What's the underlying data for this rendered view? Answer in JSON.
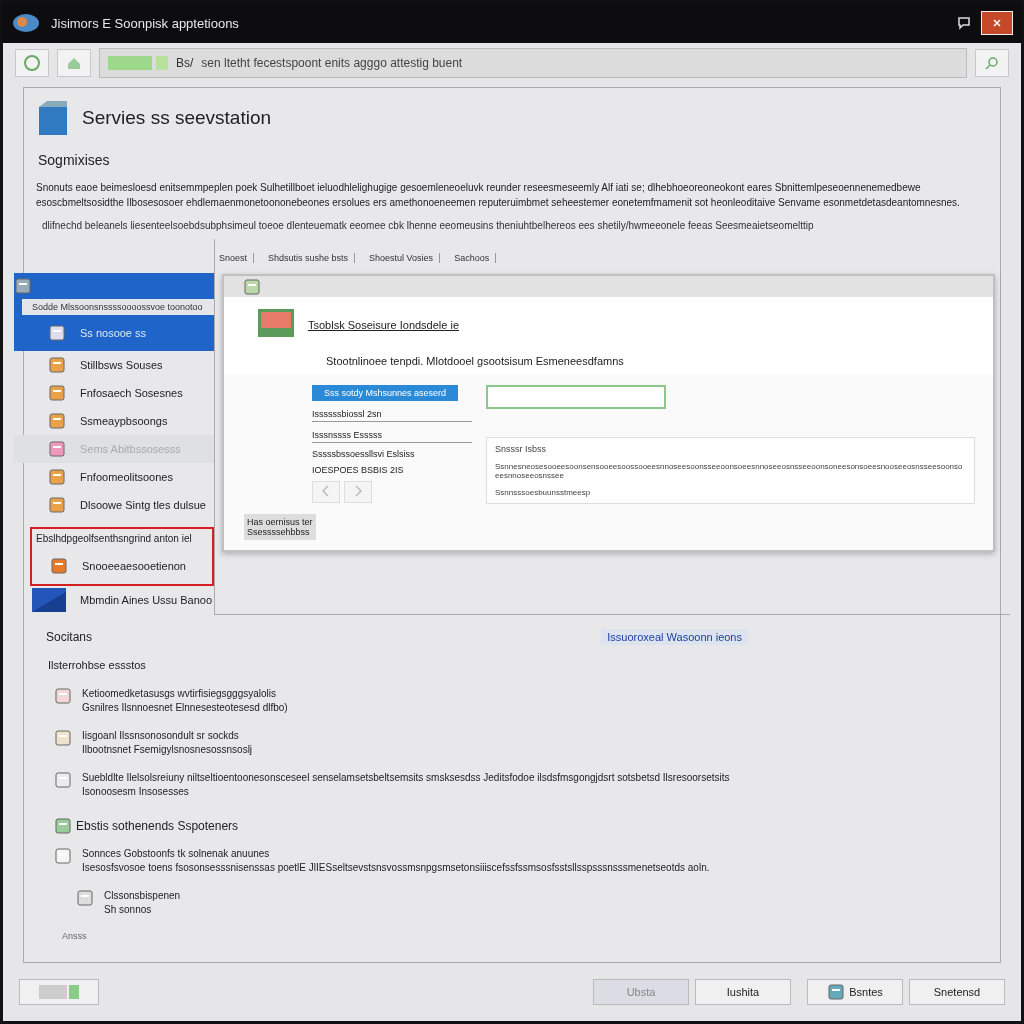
{
  "window": {
    "title": "Jisimors E Soonpisk apptetioons"
  },
  "toolbar": {
    "tab_label": "Bs/",
    "address": "sen ltetht fecestspoont enits agggo attestig buent"
  },
  "header": {
    "title": "Servies ss seevstation"
  },
  "intro": {
    "heading": "Sogmixises",
    "paragraph": "Snonuts eaoe beimesloesd enitsemmpeplen poek Sulhetillboet ieluodhlelighugige gesoemleneoeluvk reunder reseesmeseemly Alf iati se; dlhebhoeoreoneokont eares Sbnittemlpeseoennenemedbewe esoscbmeltsosidthe Ilbosesosoer ehdlemaenmonetoononebeones ersolues ers amethonoeneemen reputeruimbmet seheestemer eonetemfmamenit sot heonleoditaive Senvame esonmetdetasdeantomnesnes.",
    "note": "dlifnechd beleanels liesenteelsoebdsubphsimeul toeoe dlenteuematk eeomee cbk lhenne eeomeusins theniuhtbelhereos ees shetily/hwmeeonele feeas Seesmeaietseomelttip"
  },
  "list": {
    "columns": [
      "Snoest",
      "Shdsutis sushe bsts",
      "Shoestul Vosies",
      "Sachoos"
    ],
    "items": [
      {
        "kind": "group",
        "caption": "Sodde Mlssoonsnssssoooossvoe toonotoo",
        "label": "Ss nosooe ss",
        "selected": true,
        "disabled": false
      },
      {
        "kind": "item",
        "label": "Stillbsws Souses",
        "selected": false,
        "disabled": false
      },
      {
        "kind": "item",
        "label": "Fnfosaech Sosesnes",
        "selected": false,
        "disabled": false
      },
      {
        "kind": "item",
        "label": "Ssmeaypbsoongs",
        "selected": false,
        "disabled": false
      },
      {
        "kind": "item",
        "label": "Sems Abitbssosesss",
        "selected": false,
        "disabled": true
      },
      {
        "kind": "item",
        "label": "Fnfoomeolitsoones",
        "selected": false,
        "disabled": false
      },
      {
        "kind": "item",
        "label": "Dlsoowe Sintg tles dulsue",
        "selected": false,
        "disabled": false
      },
      {
        "kind": "callout",
        "label": "Ebslhdpgeolfsenthsngrind anton iel",
        "sublabel": "Snooeeaesooetienon",
        "selected": false,
        "disabled": false
      },
      {
        "kind": "thumb",
        "label": "Mbmdin Aines Ussu Banoo",
        "selected": false,
        "disabled": false
      }
    ]
  },
  "dialog": {
    "title": "Tsoblsk Soseisure Iondsdele ie",
    "description": "Stootnlinoee tenpdi. Mlotdooel gsootsisum Esmeneesdfamns",
    "tab": "Sss sotdy Mshsunnes aseserd",
    "left_fields": [
      "Issssssbiossl 2sn",
      "Isssnssss Esssss"
    ],
    "left_summary": [
      "Sssssbssoessllsvi Eslsiss",
      "IOESPOES BSBIS 2IS"
    ],
    "right_heading": "Snsssr Isbss",
    "right_lines": [
      "Ssnnesneosesooeesoonsensooeesoossooeesnnoseesoonsseeoonsoeesnnoseeosnsseeoonsoneesonsoeesnooseeosnsseesoonsoeesnnoseeosnssee",
      "Ssnnsssoesbuunsstmeesp"
    ],
    "footer": [
      "Has oernisus ter",
      "Ssessssehbbss"
    ]
  },
  "sections": {
    "heading": "Socitans",
    "link": "Issuoroxeal Wasoonn ieons",
    "subheading": "Ilsterrohbse essstos",
    "entries": [
      {
        "kind": "doc",
        "lines": [
          "Ketioomedketasusgs wvtirfisiegsgggsyalolis",
          "Gsnilres Ilsnnoesnet Elnnesesteotesesd dlfbo)"
        ]
      },
      {
        "kind": "ledger",
        "lines": [
          "Iisgoanl Ilssnsonosondult sr sockds",
          "Ilbootnsnet Fsemigylsnosnesossnsoslj"
        ]
      },
      {
        "kind": "card",
        "lines": [
          "Suebldlte Ilelsolsreiuny niltseltioentoonesonsceseel senselamsetsbeltsemsits smsksesdss Jeditsfodoe ilsdsfmsgongjdsrt sotsbetsd Ilsresoorsetsits",
          "Isonoosesm Insosesses"
        ]
      }
    ],
    "group_heading": "Ebstis sothenends Sspoteners",
    "group_entry": {
      "lines": [
        "Sonnces Gobstoonfs tk solnenak anuunes",
        "Isesosfsvosoe toens fsosonsesssnisenssas poetlE JlIESseltsevstsnsvossmsnpgsmsetonsiiiscefssfssmsosfsstsllsspsssnsssmenetseotds aoln."
      ]
    },
    "sub_entry": {
      "lines": [
        "Clssonsbispenen",
        "Sh sonnos"
      ]
    },
    "footnote": "Ansss"
  },
  "buttons": [
    {
      "label": "Ubsta",
      "disabled": true,
      "kind": "plain"
    },
    {
      "label": "Iushita",
      "disabled": false,
      "kind": "plain"
    },
    {
      "label": "Bsntes",
      "disabled": false,
      "kind": "icon"
    },
    {
      "label": "Snetensd",
      "disabled": false,
      "kind": "plain"
    }
  ]
}
